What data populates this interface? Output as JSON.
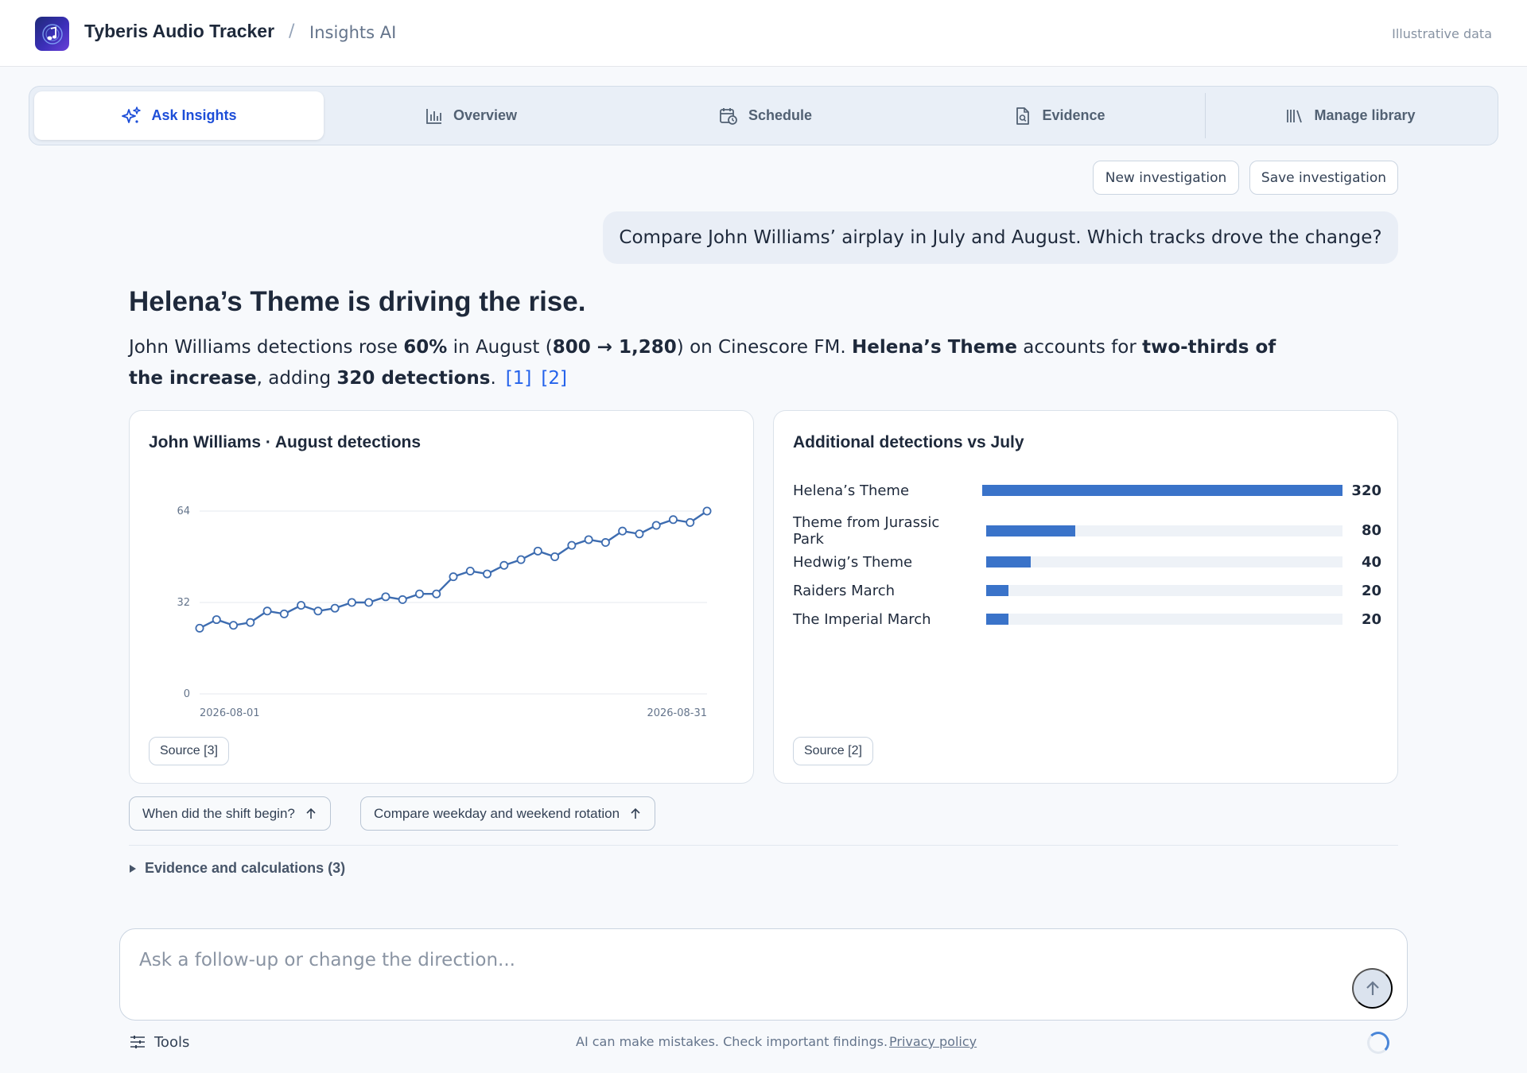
{
  "header": {
    "app_title": "Tyberis Audio Tracker",
    "separator": "/",
    "section": "Insights AI",
    "note": "Illustrative data",
    "logo_icon": "music-note-icon",
    "brand_color": "#2a2f9e"
  },
  "tabs": [
    {
      "label": "Ask Insights",
      "icon": "sparkle-icon",
      "active": true
    },
    {
      "label": "Overview",
      "icon": "bar-chart-icon",
      "active": false
    },
    {
      "label": "Schedule",
      "icon": "calendar-clock-icon",
      "active": false
    },
    {
      "label": "Evidence",
      "icon": "document-search-icon",
      "active": false
    },
    {
      "label": "Manage library",
      "icon": "library-icon",
      "active": false
    }
  ],
  "actions": {
    "new_investigation": "New investigation",
    "save_investigation": "Save investigation"
  },
  "conversation": {
    "user_message": "Compare John Williams’ airplay in July and August. Which tracks drove the change?",
    "answer_title": "Helena’s Theme is driving the rise.",
    "answer": {
      "p1": "John Williams detections rose ",
      "b1": "60%",
      "p2": " in August (",
      "b2": "800 → 1,280",
      "p3": ") on Cinescore FM. ",
      "b3": "Helena’s Theme",
      "p4": " accounts for ",
      "b4": "two-thirds of the increase",
      "p5": ", adding ",
      "b5": "320 detections",
      "p6": ".",
      "cite1": "[1]",
      "cite2": "[2]"
    }
  },
  "cards": {
    "line": {
      "title": "John Williams · August detections",
      "source": "Source [3]"
    },
    "bars": {
      "title": "Additional detections vs July",
      "source": "Source [2]"
    }
  },
  "chart_data": [
    {
      "type": "line",
      "title": "John Williams · August detections",
      "x_tick_labels": [
        "2026-08-01",
        "2026-08-31"
      ],
      "y_ticks": [
        0,
        32,
        64
      ],
      "ylim": [
        0,
        64
      ],
      "x": [
        "2026-08-01",
        "2026-08-02",
        "2026-08-03",
        "2026-08-04",
        "2026-08-05",
        "2026-08-06",
        "2026-08-07",
        "2026-08-08",
        "2026-08-09",
        "2026-08-10",
        "2026-08-11",
        "2026-08-12",
        "2026-08-13",
        "2026-08-14",
        "2026-08-15",
        "2026-08-16",
        "2026-08-17",
        "2026-08-18",
        "2026-08-19",
        "2026-08-20",
        "2026-08-21",
        "2026-08-22",
        "2026-08-23",
        "2026-08-24",
        "2026-08-25",
        "2026-08-26",
        "2026-08-27",
        "2026-08-28",
        "2026-08-29",
        "2026-08-30",
        "2026-08-31"
      ],
      "values": [
        23,
        26,
        24,
        25,
        29,
        28,
        31,
        29,
        30,
        32,
        32,
        34,
        33,
        35,
        35,
        41,
        43,
        42,
        45,
        47,
        50,
        48,
        52,
        54,
        53,
        57,
        56,
        59,
        61,
        60,
        64
      ],
      "grid": true,
      "color": "#3d6cb0"
    },
    {
      "type": "bar",
      "orientation": "horizontal",
      "title": "Additional detections vs July",
      "categories": [
        "Helena’s Theme",
        "Theme from Jurassic Park",
        "Hedwig’s Theme",
        "Raiders March",
        "The Imperial March"
      ],
      "values": [
        320,
        80,
        40,
        20,
        20
      ],
      "xlim": [
        0,
        320
      ],
      "color": "#3a73c9"
    }
  ],
  "followups": [
    {
      "label": "When did the shift begin?",
      "icon": "arrow-up-icon"
    },
    {
      "label": "Compare weekday and weekend rotation",
      "icon": "arrow-up-icon"
    }
  ],
  "evidence": {
    "label": "Evidence and calculations (3)"
  },
  "composer": {
    "placeholder": "Ask a follow-up or change the direction..."
  },
  "footer": {
    "tools": "Tools",
    "disclaimer": "AI can make mistakes. Check important findings.",
    "privacy": "Privacy policy"
  }
}
